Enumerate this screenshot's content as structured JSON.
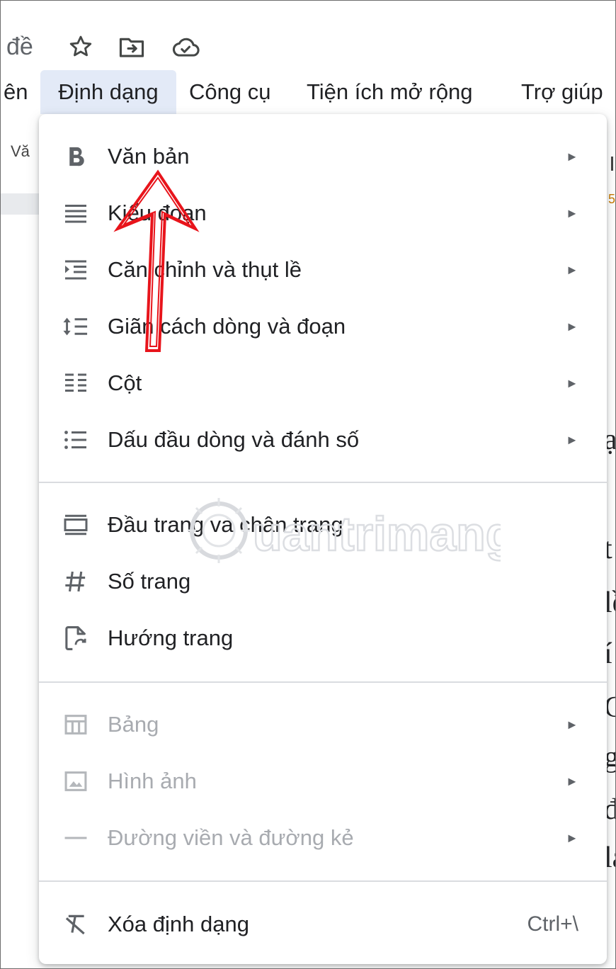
{
  "title_bar": {
    "title_fragment": "đề",
    "icons": [
      "star-icon",
      "move-to-folder-icon",
      "cloud-saved-icon"
    ]
  },
  "menubar": {
    "partial_left": "ên",
    "items": [
      {
        "label": "Định dạng",
        "active": true
      },
      {
        "label": "Công cụ"
      },
      {
        "label": "Tiện ích mở rộng"
      },
      {
        "label": "Trợ giúp"
      }
    ]
  },
  "toolbar": {
    "partial_text": "Vă"
  },
  "ruler": {
    "partial_text": "5"
  },
  "document": {
    "partial_glyphs": [
      "ạ",
      "t",
      "lề",
      "í",
      "C",
      "g",
      "đ",
      "lạ"
    ]
  },
  "format_menu": {
    "groups": [
      {
        "items": [
          {
            "label": "Văn bản",
            "icon": "bold-icon",
            "submenu": true
          },
          {
            "label": "Kiểu đoạn",
            "icon": "paragraph-style-icon",
            "submenu": true
          },
          {
            "label": "Căn chỉnh và thụt lề",
            "icon": "align-indent-icon",
            "submenu": true
          },
          {
            "label": "Giãn cách dòng và đoạn",
            "icon": "line-spacing-icon",
            "submenu": true
          },
          {
            "label": "Cột",
            "icon": "columns-icon",
            "submenu": true
          },
          {
            "label": "Dấu đầu dòng và đánh số",
            "icon": "bulleted-list-icon",
            "submenu": true
          }
        ]
      },
      {
        "items": [
          {
            "label": "Đầu trang và chân trang",
            "icon": "header-footer-icon"
          },
          {
            "label": "Số trang",
            "icon": "page-number-icon"
          },
          {
            "label": "Hướng trang",
            "icon": "page-orientation-icon"
          }
        ]
      },
      {
        "items": [
          {
            "label": "Bảng",
            "icon": "table-icon",
            "submenu": true,
            "disabled": true
          },
          {
            "label": "Hình ảnh",
            "icon": "image-icon",
            "submenu": true,
            "disabled": true
          },
          {
            "label": "Đường viền và đường kẻ",
            "icon": "border-line-icon",
            "submenu": true,
            "disabled": true
          }
        ]
      },
      {
        "items": [
          {
            "label": "Xóa định dạng",
            "icon": "clear-formatting-icon",
            "shortcut": "Ctrl+\\"
          }
        ]
      }
    ],
    "submenu_arrow": "►"
  },
  "watermark": {
    "text": "uantrimang"
  },
  "annotation": {
    "color": "#e8141b"
  },
  "colors": {
    "menu_active_bg": "#e3eaf7",
    "icon": "#5f6368",
    "disabled": "#a8abb0"
  }
}
